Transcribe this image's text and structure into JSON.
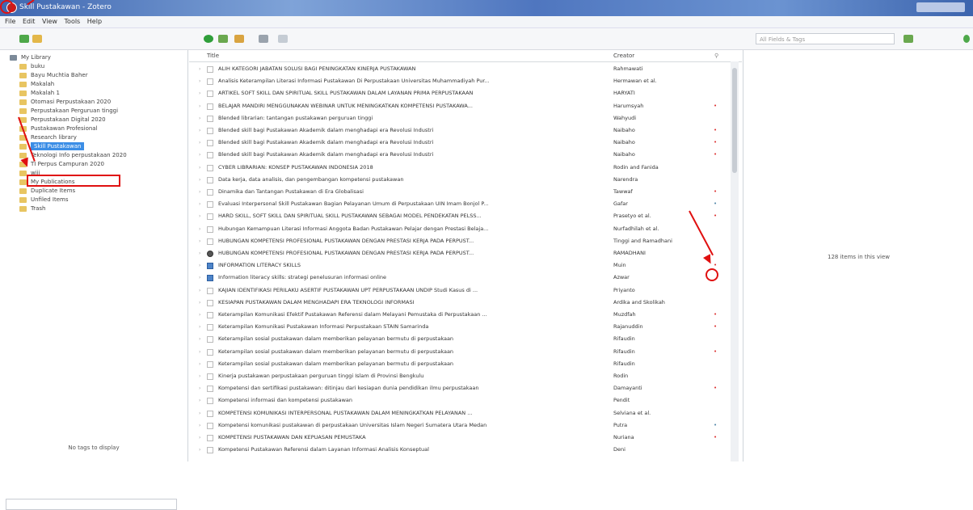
{
  "window": {
    "title": "Skill Pustakawan - Zotero"
  },
  "menu": [
    "File",
    "Edit",
    "View",
    "Tools",
    "Help"
  ],
  "search": {
    "placeholder": "All Fields & Tags"
  },
  "tree": [
    {
      "label": "My Library",
      "indent": 0,
      "icon": "library"
    },
    {
      "label": "buku",
      "indent": 1
    },
    {
      "label": "Bayu Muchtia Baher",
      "indent": 1
    },
    {
      "label": "Makalah",
      "indent": 1
    },
    {
      "label": "Makalah 1",
      "indent": 1
    },
    {
      "label": "Otomasi Perpustakaan 2020",
      "indent": 1
    },
    {
      "label": "Perpustakaan Perguruan tinggi",
      "indent": 1
    },
    {
      "label": "Perpustakaan Digital 2020",
      "indent": 1
    },
    {
      "label": "Pustakawan Profesional",
      "indent": 1
    },
    {
      "label": "Research library",
      "indent": 1
    },
    {
      "label": "Skill Pustakawan",
      "indent": 1,
      "selected": true
    },
    {
      "label": "Teknologi Info perpustakaan 2020",
      "indent": 1
    },
    {
      "label": "TI Perpus Campuran 2020",
      "indent": 1
    },
    {
      "label": "wiji",
      "indent": 1
    },
    {
      "label": "My Publications",
      "indent": 1
    },
    {
      "label": "Duplicate Items",
      "indent": 1
    },
    {
      "label": "Unfiled Items",
      "indent": 1
    },
    {
      "label": "Trash",
      "indent": 1
    }
  ],
  "tags": {
    "empty_text": "No tags to display"
  },
  "columns": {
    "title": "Title",
    "creator": "Creator"
  },
  "items": [
    {
      "title": "ALIH KATEGORI JABATAN SOLUSI BAGI PENINGKATAN KINERJA PUSTAKAWAN",
      "creator": "Rahmawati",
      "mark": ""
    },
    {
      "title": "Analisis Keterampilan Literasi Informasi Pustakawan Di Perpustakaan Universitas Muhammadiyah Pur...",
      "creator": "Hermawan et al.",
      "mark": ""
    },
    {
      "title": "ARTIKEL SOFT SKILL DAN SPIRITUAL SKILL PUSTAKAWAN DALAM LAYANAN PRIMA PERPUSTAKAAN",
      "creator": "HARYATI",
      "mark": ""
    },
    {
      "title": "BELAJAR MANDIRI MENGGUNAKAN WEBINAR UNTUK MENINGKATKAN KOMPETENSI PUSTAKAWA...",
      "creator": "Harumsyah",
      "mark": "red"
    },
    {
      "title": "Blended librarian: tantangan pustakawan perguruan tinggi",
      "creator": "Wahyudi",
      "mark": ""
    },
    {
      "title": "Blended skill bagi Pustakawan Akademik dalam menghadapi era Revolusi Industri",
      "creator": "Naibaho",
      "mark": "red"
    },
    {
      "title": "Blended skill bagi Pustakawan Akademik dalam menghadapi era Revolusi Industri",
      "creator": "Naibaho",
      "mark": "red"
    },
    {
      "title": "Blended skill bagi Pustakawan Akademik dalam menghadapi era Revolusi Industri",
      "creator": "Naibaho",
      "mark": "red"
    },
    {
      "title": "CYBER LIBRARIAN: KONSEP PUSTAKAWAN INDONESIA 2018",
      "creator": "Rodin and Fanida",
      "mark": ""
    },
    {
      "title": "Data kerja, data analisis, dan pengembangan kompetensi pustakawan",
      "creator": "Narendra",
      "mark": ""
    },
    {
      "title": "Dinamika dan Tantangan Pustakawan di Era Globalisasi",
      "creator": "Tawwaf",
      "mark": "red"
    },
    {
      "title": "Evaluasi Interpersonal Skill Pustakawan Bagian Pelayanan Umum di Perpustakaan UIN Imam Bonjol P...",
      "creator": "Gafar",
      "mark": "blue"
    },
    {
      "title": "HARD SKILL, SOFT SKILL DAN SPIRITUAL SKILL PUSTAKAWAN SEBAGAI MODEL PENDEKATAN PELSS...",
      "creator": "Prasetyo et al.",
      "mark": "red"
    },
    {
      "title": "Hubungan Kemampuan Literasi Informasi Anggota Badan Pustakawan Pelajar dengan Prestasi Belaja...",
      "creator": "Nurfadhilah et al.",
      "mark": ""
    },
    {
      "title": "HUBUNGAN KOMPETENSI PROFESIONAL PUSTAKAWAN DENGAN PRESTASI KERJA PADA PERPUST...",
      "creator": "Tinggi and Ramadhani",
      "mark": ""
    },
    {
      "title": "HUBUNGAN KOMPETENSI PROFESIONAL PUSTAKAWAN DENGAN PRESTASI KERJA PADA PERPUST...",
      "creator": "RAMADHANI",
      "mark": "",
      "icon": "dark"
    },
    {
      "title": "INFORMATION LITERACY SKILLS",
      "creator": "Muin",
      "mark": "red",
      "icon": "blue"
    },
    {
      "title": "Information literacy skills: strategi penelusuran informasi online",
      "creator": "Azwar",
      "mark": "",
      "icon": "blue"
    },
    {
      "title": "KAJIAN IDENTIFIKASI PERILAKU ASERTIF PUSTAKAWAN UPT PERPUSTAKAAN UNDIP Studi Kasus di ...",
      "creator": "Priyanto",
      "mark": ""
    },
    {
      "title": "KESIAPAN PUSTAKAWAN DALAM MENGHADAPI ERA TEKNOLOGI INFORMASI",
      "creator": "Ardika and Skolikah",
      "mark": ""
    },
    {
      "title": "Keterampilan Komunikasi Efektif Pustakawan Referensi dalam Melayani Pemustaka di Perpustakaan ...",
      "creator": "Muzdfah",
      "mark": "red"
    },
    {
      "title": "Keterampilan Komunikasi Pustakawan Informasi Perpustakaan STAIN Samarinda",
      "creator": "Rajanuddin",
      "mark": "red"
    },
    {
      "title": "Keterampilan sosial pustakawan dalam memberikan pelayanan bermutu di perpustakaan",
      "creator": "Rifaudin",
      "mark": ""
    },
    {
      "title": "Keterampilan sosial pustakawan dalam memberikan pelayanan bermutu di perpustakaan",
      "creator": "Rifaudin",
      "mark": "red"
    },
    {
      "title": "Keterampilan sosial pustakawan dalam memberikan pelayanan bermutu di perpustakaan",
      "creator": "Rifaudin",
      "mark": ""
    },
    {
      "title": "Kinerja pustakawan perpustakaan perguruan tinggi Islam di Provinsi Bengkulu",
      "creator": "Rodin",
      "mark": ""
    },
    {
      "title": "Kompetensi dan sertifikasi pustakawan: ditinjau dari kesiapan dunia pendidikan ilmu perpustakaan",
      "creator": "Damayanti",
      "mark": "red"
    },
    {
      "title": "Kompetensi informasi dan kompetensi pustakawan",
      "creator": "Pendit",
      "mark": ""
    },
    {
      "title": "KOMPETENSI KOMUNIKASI INTERPERSONAL PUSTAKAWAN DALAM MENINGKATKAN PELAYANAN ...",
      "creator": "Selviana et al.",
      "mark": ""
    },
    {
      "title": "Kompetensi komunikasi pustakawan di perpustakaan Universitas Islam Negeri Sumatera Utara Medan",
      "creator": "Putra",
      "mark": "blue"
    },
    {
      "title": "KOMPETENSI PUSTAKAWAN DAN KEPUASAN PEMUSTAKA",
      "creator": "Nuriana",
      "mark": "red"
    },
    {
      "title": "Kompetensi Pustakawan Referensi dalam Layanan Informasi Analisis Konseptual",
      "creator": "Deni",
      "mark": ""
    }
  ],
  "right": {
    "count_text": "128 items in this view"
  }
}
